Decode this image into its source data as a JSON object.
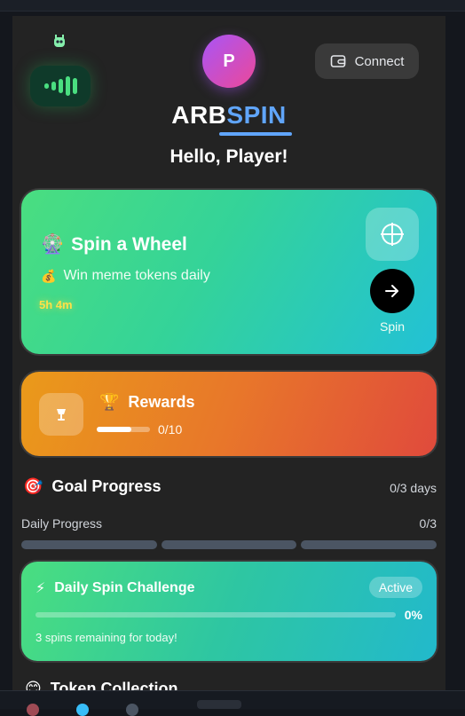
{
  "header": {
    "avatar_initial": "P",
    "connect_label": "Connect",
    "brand_left": "ARB",
    "brand_right": "SPIN",
    "greeting": "Hello, Player!"
  },
  "spin_card": {
    "emoji": "🎡",
    "title": "Spin a Wheel",
    "sub_emoji": "💰",
    "subtitle": "Win meme tokens daily",
    "timer": "5h 4m",
    "button_label": "Spin"
  },
  "rewards": {
    "emoji": "🏆",
    "title": "Rewards",
    "progress": 0.65,
    "count": "0/10"
  },
  "goal": {
    "emoji": "🎯",
    "title": "Goal Progress",
    "days": "0/3 days",
    "daily_label": "Daily Progress",
    "daily_count": "0/3"
  },
  "challenge": {
    "emoji": "⚡",
    "title": "Daily Spin Challenge",
    "status": "Active",
    "percent": "0%",
    "progress": 0.0,
    "remaining": "3 spins remaining for today!"
  },
  "collection": {
    "emoji": "😊",
    "title": "Token Collection"
  },
  "colors": {
    "accent": "#60a5fa",
    "spin_card_from": "#4ade80",
    "spin_card_to": "#22c1d6",
    "rewards_from": "#ea9a1a",
    "rewards_to": "#e04a3c",
    "timer": "#fde047"
  },
  "icons": {
    "robot": "robot-icon",
    "music": "sound-wave-icon",
    "wallet": "wallet-icon",
    "target": "crosshair-icon",
    "arrow": "arrow-right-icon",
    "lamp": "lamp-icon"
  }
}
